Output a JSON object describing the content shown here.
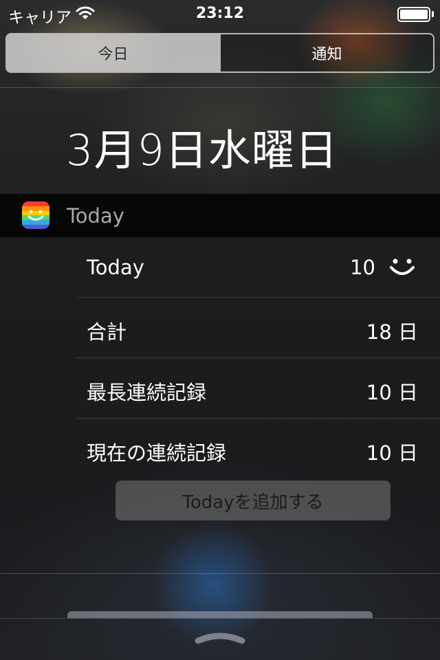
{
  "status_bar": {
    "carrier": "キャリア",
    "time": "23:12"
  },
  "tabs": [
    {
      "label": "今日",
      "selected": true
    },
    {
      "label": "通知",
      "selected": false
    }
  ],
  "date_header": "3月9日水曜日",
  "widget": {
    "app_name": "Today",
    "rows": [
      {
        "label": "Today",
        "value": "10",
        "icon": "smile-icon"
      },
      {
        "label": "合計",
        "value": "18 日"
      },
      {
        "label": "最長連続記録",
        "value": "10 日"
      },
      {
        "label": "現在の連続記録",
        "value": "10 日"
      }
    ],
    "add_button_label": "Todayを追加する"
  },
  "colors": {
    "icon_stripes": [
      "#ff3b30",
      "#ff9500",
      "#ffcc00",
      "#4cd964",
      "#34aadc",
      "#5856d6"
    ]
  }
}
